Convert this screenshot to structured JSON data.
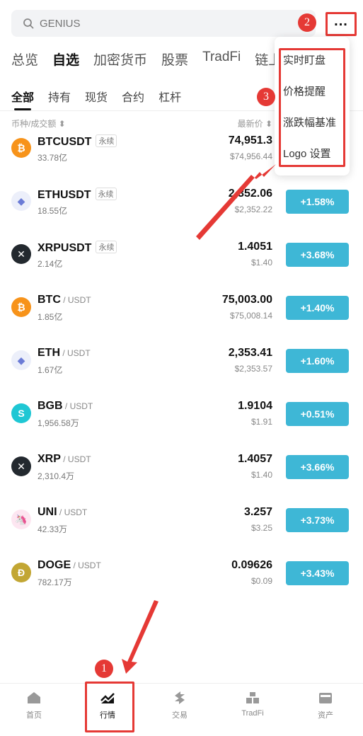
{
  "search": {
    "placeholder": "GENIUS"
  },
  "top_tabs": [
    "总览",
    "自选",
    "加密货币",
    "股票",
    "TradFi",
    "链上"
  ],
  "sub_tabs": [
    "全部",
    "持有",
    "现货",
    "合约",
    "杠杆"
  ],
  "columns": {
    "left": "币种/成交额 ⬍",
    "right": "最新价 ⬍"
  },
  "menu": [
    "实时盯盘",
    "价格提醒",
    "涨跌幅基准",
    "Logo 设置"
  ],
  "perp_label": "永续",
  "rows": [
    {
      "symbol": "BTCUSDT",
      "quote": "",
      "perp": true,
      "volume": "33.78亿",
      "price": "74,951.3",
      "fiat": "$74,956.44",
      "change": "",
      "icon": "bitcoin-icon",
      "color": "#f7931a",
      "glyph": "₿"
    },
    {
      "symbol": "ETHUSDT",
      "quote": "",
      "perp": true,
      "volume": "18.55亿",
      "price": "2,352.06",
      "fiat": "$2,352.22",
      "change": "+1.58%",
      "icon": "ethereum-icon",
      "color": "#eceffa",
      "glyph": "◆"
    },
    {
      "symbol": "XRPUSDT",
      "quote": "",
      "perp": true,
      "volume": "2.14亿",
      "price": "1.4051",
      "fiat": "$1.40",
      "change": "+3.68%",
      "icon": "xrp-icon",
      "color": "#23292f",
      "glyph": "✕"
    },
    {
      "symbol": "BTC",
      "quote": " / USDT",
      "perp": false,
      "volume": "1.85亿",
      "price": "75,003.00",
      "fiat": "$75,008.14",
      "change": "+1.40%",
      "icon": "bitcoin-icon",
      "color": "#f7931a",
      "glyph": "₿"
    },
    {
      "symbol": "ETH",
      "quote": " / USDT",
      "perp": false,
      "volume": "1.67亿",
      "price": "2,353.41",
      "fiat": "$2,353.57",
      "change": "+1.60%",
      "icon": "ethereum-icon",
      "color": "#eceffa",
      "glyph": "◆"
    },
    {
      "symbol": "BGB",
      "quote": " / USDT",
      "perp": false,
      "volume": "1,956.58万",
      "price": "1.9104",
      "fiat": "$1.91",
      "change": "+0.51%",
      "icon": "bgb-icon",
      "color": "#1fc7d4",
      "glyph": "S"
    },
    {
      "symbol": "XRP",
      "quote": " / USDT",
      "perp": false,
      "volume": "2,310.4万",
      "price": "1.4057",
      "fiat": "$1.40",
      "change": "+3.66%",
      "icon": "xrp-icon",
      "color": "#23292f",
      "glyph": "✕"
    },
    {
      "symbol": "UNI",
      "quote": " / USDT",
      "perp": false,
      "volume": "42.33万",
      "price": "3.257",
      "fiat": "$3.25",
      "change": "+3.73%",
      "icon": "uniswap-icon",
      "color": "#fde6f1",
      "glyph": "🦄"
    },
    {
      "symbol": "DOGE",
      "quote": " / USDT",
      "perp": false,
      "volume": "782.17万",
      "price": "0.09626",
      "fiat": "$0.09",
      "change": "+3.43%",
      "icon": "dogecoin-icon",
      "color": "#c2a633",
      "glyph": "Ð"
    }
  ],
  "nav": [
    {
      "label": "首页",
      "icon": "home-icon"
    },
    {
      "label": "行情",
      "icon": "market-chart-icon"
    },
    {
      "label": "交易",
      "icon": "trade-icon"
    },
    {
      "label": "TradFi",
      "icon": "tradfi-icon"
    },
    {
      "label": "资产",
      "icon": "wallet-icon"
    }
  ],
  "annotations": [
    "1",
    "2",
    "3"
  ],
  "colors": {
    "accent": "#3eb7d6",
    "annotation": "#e53935"
  }
}
